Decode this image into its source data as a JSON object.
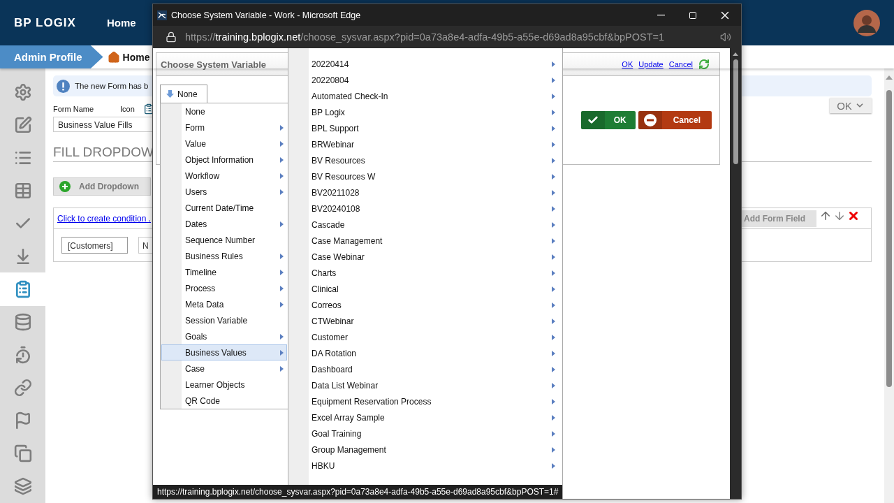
{
  "app": {
    "logo": "BP LOGIX",
    "nav": [
      {
        "label": "Home"
      }
    ],
    "breadcrumb": [
      {
        "label": "Admin Profile",
        "kind": "profile"
      },
      {
        "label": "Home",
        "kind": "home"
      }
    ]
  },
  "sidebar": {
    "items": [
      {
        "selected": false
      },
      {
        "selected": false
      },
      {
        "selected": false
      },
      {
        "selected": false
      },
      {
        "selected": false
      },
      {
        "selected": false
      },
      {
        "selected": true
      },
      {
        "selected": false
      },
      {
        "selected": false
      },
      {
        "selected": false
      },
      {
        "selected": false
      },
      {
        "selected": false
      },
      {
        "selected": false
      }
    ]
  },
  "form": {
    "notice": "The new Form has b",
    "form_name_label": "Form Name",
    "icon_label": "Icon",
    "form_name": "Business Value Fills",
    "ok_button": "OK",
    "heading": "FILL DROPDOW",
    "add_dropdown": "Add Dropdown",
    "condition_link": "Click to create condition .",
    "add_form_field": "Add Form Field",
    "fields": [
      "[Customers]",
      "N"
    ]
  },
  "popup": {
    "title": "Choose System Variable - Work - Microsoft Edge",
    "url_scheme": "https://",
    "url_host": "training.bplogix.net",
    "url_path": "/choose_sysvar.aspx?pid=0a73a8e4-adfa-49b5-a55e-d69ad8a95cbf&bpPOST=1",
    "dialog_title": "Choose System Variable",
    "header_links": [
      "OK",
      "Update",
      "Cancel"
    ],
    "dropdown": "None",
    "ok_button": "OK",
    "cancel_button": "Cancel",
    "menu": [
      {
        "label": "None",
        "has_submenu": false,
        "selected": false
      },
      {
        "label": "Form",
        "has_submenu": true,
        "selected": false
      },
      {
        "label": "Value",
        "has_submenu": true,
        "selected": false
      },
      {
        "label": "Object Information",
        "has_submenu": true,
        "selected": false
      },
      {
        "label": "Workflow",
        "has_submenu": true,
        "selected": false
      },
      {
        "label": "Users",
        "has_submenu": true,
        "selected": false
      },
      {
        "label": "Current Date/Time",
        "has_submenu": false,
        "selected": false
      },
      {
        "label": "Dates",
        "has_submenu": true,
        "selected": false
      },
      {
        "label": "Sequence Number",
        "has_submenu": false,
        "selected": false
      },
      {
        "label": "Business Rules",
        "has_submenu": true,
        "selected": false
      },
      {
        "label": "Timeline",
        "has_submenu": true,
        "selected": false
      },
      {
        "label": "Process",
        "has_submenu": true,
        "selected": false
      },
      {
        "label": "Meta Data",
        "has_submenu": true,
        "selected": false
      },
      {
        "label": "Session Variable",
        "has_submenu": false,
        "selected": false
      },
      {
        "label": "Goals",
        "has_submenu": true,
        "selected": false
      },
      {
        "label": "Business Values",
        "has_submenu": true,
        "selected": true
      },
      {
        "label": "Case",
        "has_submenu": true,
        "selected": false
      },
      {
        "label": "Learner Objects",
        "has_submenu": false,
        "selected": false
      },
      {
        "label": "QR Code",
        "has_submenu": false,
        "selected": false
      }
    ],
    "submenu": [
      "20220414",
      "20220804",
      "Automated Check-In",
      "BP Logix",
      "BPL Support",
      "BRWebinar",
      "BV Resources",
      "BV Resources W",
      "BV20211028",
      "BV20240108",
      "Cascade",
      "Case Management",
      "Case Webinar",
      "Charts",
      "Clinical",
      "Correos",
      "CTWebinar",
      "Customer",
      "DA Rotation",
      "Dashboard",
      "Data List Webinar",
      "Equipment Reservation Process",
      "Excel Array Sample",
      "Goal Training",
      "Group Management",
      "HBKU"
    ],
    "status_url": "https://training.bplogix.net/choose_sysvar.aspx?pid=0a73a8e4-adfa-49b5-a55e-d69ad8a95cbf&bpPOST=1#"
  }
}
